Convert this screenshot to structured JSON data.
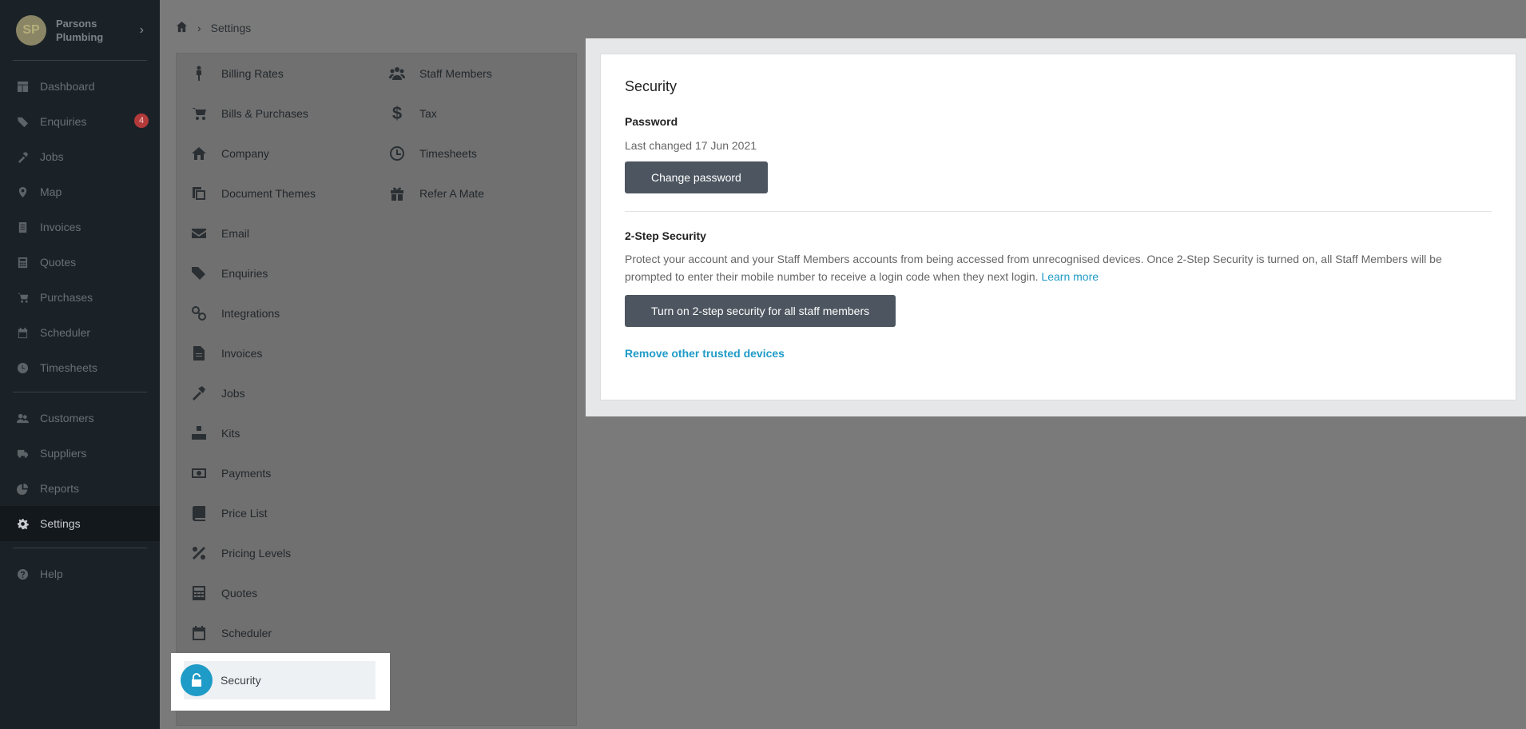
{
  "brand": {
    "initials": "SP",
    "name": "Parsons Plumbing"
  },
  "sidebar": {
    "group1": [
      {
        "label": "Dashboard",
        "icon": "dashboard-icon"
      },
      {
        "label": "Enquiries",
        "icon": "tags-icon",
        "badge": "4"
      },
      {
        "label": "Jobs",
        "icon": "hammer-icon"
      },
      {
        "label": "Map",
        "icon": "map-pin-icon"
      },
      {
        "label": "Invoices",
        "icon": "invoice-icon"
      },
      {
        "label": "Quotes",
        "icon": "calculator-icon"
      },
      {
        "label": "Purchases",
        "icon": "cart-icon"
      },
      {
        "label": "Scheduler",
        "icon": "calendar-icon"
      },
      {
        "label": "Timesheets",
        "icon": "clock-icon"
      }
    ],
    "group2": [
      {
        "label": "Customers",
        "icon": "users-icon"
      },
      {
        "label": "Suppliers",
        "icon": "truck-icon"
      },
      {
        "label": "Reports",
        "icon": "pie-chart-icon"
      },
      {
        "label": "Settings",
        "icon": "gear-icon",
        "active": true
      }
    ],
    "group3": [
      {
        "label": "Help",
        "icon": "help-icon"
      }
    ]
  },
  "breadcrumb": {
    "current": "Settings"
  },
  "settings_menu": {
    "col1": [
      {
        "label": "Billing Rates",
        "icon": "person-icon"
      },
      {
        "label": "Bills & Purchases",
        "icon": "cart-icon"
      },
      {
        "label": "Company",
        "icon": "home-icon"
      },
      {
        "label": "Document Themes",
        "icon": "copy-icon"
      },
      {
        "label": "Email",
        "icon": "envelope-icon"
      },
      {
        "label": "Enquiries",
        "icon": "tags-icon"
      },
      {
        "label": "Integrations",
        "icon": "link-icon"
      },
      {
        "label": "Invoices",
        "icon": "file-icon"
      },
      {
        "label": "Jobs",
        "icon": "hammer-icon"
      },
      {
        "label": "Kits",
        "icon": "cubes-icon"
      },
      {
        "label": "Payments",
        "icon": "money-icon"
      },
      {
        "label": "Price List",
        "icon": "book-icon"
      },
      {
        "label": "Pricing Levels",
        "icon": "percent-icon"
      },
      {
        "label": "Quotes",
        "icon": "calculator-icon"
      },
      {
        "label": "Scheduler",
        "icon": "calendar-icon"
      }
    ],
    "col2": [
      {
        "label": "Staff Members",
        "icon": "users-icon"
      },
      {
        "label": "Tax",
        "icon": "dollar-icon"
      },
      {
        "label": "Timesheets",
        "icon": "clock-icon"
      },
      {
        "label": "Refer A Mate",
        "icon": "gift-icon"
      }
    ],
    "security": {
      "label": "Security",
      "icon": "unlock-icon"
    }
  },
  "security_card": {
    "title": "Security",
    "password_heading": "Password",
    "last_changed": "Last changed 17 Jun 2021",
    "change_password_label": "Change password",
    "two_step_heading": "2-Step Security",
    "two_step_text": "Protect your account and your Staff Members accounts from being accessed from unrecognised devices. Once 2-Step Security is turned on, all Staff Members will be prompted to enter their mobile number to receive a login code when they next login.",
    "learn_more": "Learn more",
    "turn_on_label": "Turn on 2-step security for all staff members",
    "remove_devices": "Remove other trusted devices"
  },
  "colors": {
    "accent": "#1f9bc7",
    "sidebar_bg": "#1b2227",
    "button_bg": "#4d5660",
    "badge": "#b23a3a"
  }
}
